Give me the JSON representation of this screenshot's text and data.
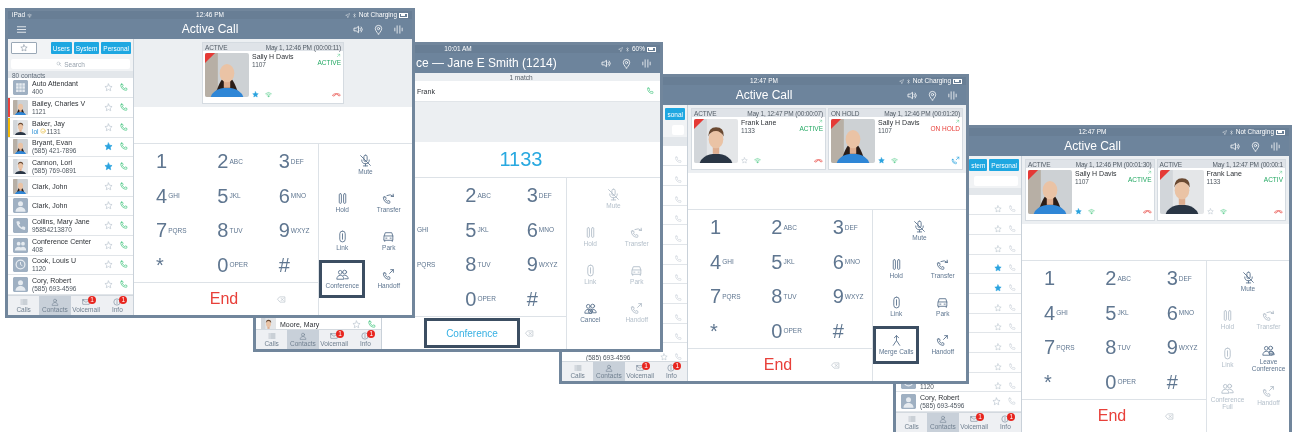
{
  "screens": [
    {
      "kind": "call",
      "status_bar": {
        "carrier": "iPad",
        "time": "12:46 PM",
        "battery": "Not Charging"
      },
      "title_bar": {
        "title": "Active Call",
        "menu": true
      },
      "sidebar": {
        "filters": [
          {
            "kind": "favorites"
          },
          {
            "kind": "text",
            "label": "Users"
          },
          {
            "kind": "text",
            "label": "System"
          },
          {
            "kind": "text",
            "label": "Personal"
          }
        ],
        "search_field": true,
        "search_placeholder": "Search",
        "count": "80 contacts",
        "contacts": [
          {
            "name": "Auto Attendant",
            "number": "400",
            "avatar": {
              "kind": "grid"
            },
            "favorite": false,
            "call_enabled": true
          },
          {
            "name": "Bailey, Charles V",
            "number": "1121",
            "color": "#e8403a",
            "favorite": false,
            "call_enabled": true
          },
          {
            "name": "Baker, Jay",
            "note": "lol",
            "number": "1131",
            "color": "#f2b705",
            "favorite": false,
            "call_enabled": true
          },
          {
            "name": "Bryant, Evan",
            "number": "(585) 421-7896",
            "favorite": true,
            "call_enabled": true
          },
          {
            "name": "Cannon, Lori",
            "number": "(585) 769-0891",
            "favorite": true,
            "call_enabled": true
          },
          {
            "name": "Clark, John",
            "favorite": false,
            "call_enabled": true
          },
          {
            "name": "Clark, John",
            "avatar": {
              "kind": "person"
            },
            "favorite": false,
            "call_enabled": true
          },
          {
            "name": "Collins, Mary Jane",
            "number": "95854213870",
            "avatar": {
              "kind": "phone"
            },
            "favorite": false,
            "call_enabled": true
          },
          {
            "name": "Conference Center",
            "number": "408",
            "avatar": {
              "kind": "group"
            },
            "favorite": false,
            "call_enabled": true
          },
          {
            "name": "Cook, Louis U",
            "number": "1120",
            "avatar": {
              "kind": "clock"
            },
            "favorite": false,
            "call_enabled": true
          },
          {
            "name": "Cory, Robert",
            "number": "(585) 693-4596",
            "avatar": {
              "kind": "person"
            },
            "favorite": false,
            "call_enabled": true
          }
        ],
        "tabs": [
          {
            "label": "Calls",
            "selected": false
          },
          {
            "label": "Contacts",
            "selected": true
          },
          {
            "label": "Voicemail",
            "selected": false,
            "badge": "1"
          },
          {
            "label": "Info",
            "selected": false,
            "badge": "1"
          }
        ]
      },
      "calls": [
        {
          "header": "ACTIVE",
          "date": "May 1, 12:46 PM",
          "duration": "(00:00:11)",
          "name": "Sally H Davis",
          "number": "1107",
          "status": "ACTIVE",
          "on_hold": false,
          "favorite": true
        }
      ],
      "keypad": [
        [
          {
            "digit": "1"
          },
          {
            "digit": "2",
            "letters": "ABC"
          },
          {
            "digit": "3",
            "letters": "DEF"
          }
        ],
        [
          {
            "digit": "4",
            "letters": "GHI"
          },
          {
            "digit": "5",
            "letters": "JKL"
          },
          {
            "digit": "6",
            "letters": "MNO"
          }
        ],
        [
          {
            "digit": "7",
            "letters": "PQRS"
          },
          {
            "digit": "8",
            "letters": "TUV"
          },
          {
            "digit": "9",
            "letters": "WXYZ"
          }
        ],
        [
          {
            "digit": "*"
          },
          {
            "digit": "0",
            "letters": "OPER"
          },
          {
            "digit": "#"
          }
        ]
      ],
      "actions": [
        {
          "kind": "mute",
          "label": "Mute",
          "disabled": false,
          "highlighted": false
        },
        {
          "kind": "hold",
          "label": "Hold",
          "disabled": false,
          "highlighted": false
        },
        {
          "kind": "transfer",
          "label": "Transfer",
          "disabled": false,
          "highlighted": false
        },
        {
          "kind": "link",
          "label": "Link",
          "disabled": false,
          "highlighted": false
        },
        {
          "kind": "park",
          "label": "Park",
          "disabled": false,
          "highlighted": false
        },
        {
          "kind": "conference",
          "label": "Conference",
          "disabled": false,
          "highlighted": true
        },
        {
          "kind": "handoff",
          "label": "Handoff",
          "disabled": false,
          "highlighted": false
        }
      ],
      "bottom": {
        "kind": "end",
        "label": "End",
        "highlighted": false
      }
    },
    {
      "kind": "dial",
      "status_bar": {
        "time": "10:01 AM",
        "battery": "60%"
      },
      "title_bar": {
        "title": "ce — Jane E Smith (1214)"
      },
      "sidebar": {
        "contacts": [
          {
            "name": "Moore, Mary",
            "favorite": false,
            "call_enabled": true
          }
        ],
        "tabs": [
          {
            "label": "Calls",
            "selected": false
          },
          {
            "label": "Contacts",
            "selected": true
          },
          {
            "label": "Voicemail",
            "selected": false,
            "badge": "1"
          },
          {
            "label": "Info",
            "selected": false,
            "badge": "1"
          }
        ]
      },
      "search_results": {
        "summary": "1 match",
        "items": [
          {
            "name": "Frank"
          }
        ]
      },
      "dial_display": "1133",
      "keypad": [
        [
          {
            "digit": "2",
            "letters": "ABC"
          },
          {
            "digit": "3",
            "letters": "DEF"
          }
        ],
        [
          {
            "letters": "GHI"
          },
          {
            "digit": "5",
            "letters": "JKL"
          },
          {
            "digit": "6",
            "letters": "MNO"
          }
        ],
        [
          {
            "letters": "PQRS"
          },
          {
            "digit": "8",
            "letters": "TUV"
          },
          {
            "digit": "9",
            "letters": "WXYZ"
          }
        ],
        [
          {
            "digit": "0",
            "letters": "OPER"
          },
          {
            "digit": "#"
          }
        ]
      ],
      "actions": [
        {
          "kind": "mute",
          "label": "Mute",
          "disabled": true,
          "highlighted": false
        },
        {
          "kind": "hold",
          "label": "Hold",
          "disabled": true,
          "highlighted": false
        },
        {
          "kind": "transfer",
          "label": "Transfer",
          "disabled": true,
          "highlighted": false
        },
        {
          "kind": "link",
          "label": "Link",
          "disabled": true,
          "highlighted": false
        },
        {
          "kind": "park",
          "label": "Park",
          "disabled": true,
          "highlighted": false
        },
        {
          "kind": "cancel",
          "label": "Cancel",
          "disabled": false,
          "highlighted": false
        },
        {
          "kind": "handoff",
          "label": "Handoff",
          "disabled": true,
          "highlighted": false
        }
      ],
      "bottom": {
        "kind": "conference",
        "label": "Conference",
        "highlighted": true
      }
    },
    {
      "kind": "call",
      "status_bar": {
        "time": "12:47 PM",
        "battery": "Not Charging"
      },
      "title_bar": {
        "title": "Active Call"
      },
      "sidebar": {
        "filters": [
          {
            "kind": "text",
            "label": "sonal"
          }
        ],
        "search_field": true,
        "contacts": [
          {
            "call_enabled": false
          },
          {
            "call_enabled": false
          },
          {
            "call_enabled": false
          },
          {
            "call_enabled": false
          },
          {
            "call_enabled": false
          },
          {
            "call_enabled": false
          },
          {
            "call_enabled": false
          },
          {
            "call_enabled": false
          },
          {
            "call_enabled": false
          },
          {
            "call_enabled": false
          },
          {
            "number": "(585) 693-4596",
            "favorite": false,
            "call_enabled": false
          }
        ],
        "tabs": [
          {
            "label": "Calls",
            "selected": false
          },
          {
            "label": "Contacts",
            "selected": true
          },
          {
            "label": "Voicemail",
            "selected": false,
            "badge": "1"
          },
          {
            "label": "Info",
            "selected": false,
            "badge": "1"
          }
        ]
      },
      "calls": [
        {
          "header": "ACTIVE",
          "date": "May 1, 12:47 PM",
          "duration": "(00:00:07)",
          "name": "Frank Lane",
          "number": "1133",
          "status": "ACTIVE",
          "on_hold": false,
          "favorite": false
        },
        {
          "header": "ON HOLD",
          "date": "May 1, 12:46 PM",
          "duration": "(00:01:20)",
          "name": "Sally H Davis",
          "number": "1107",
          "status": "ON HOLD",
          "on_hold": true,
          "favorite": true
        }
      ],
      "keypad": [
        [
          {
            "digit": "1"
          },
          {
            "digit": "2",
            "letters": "ABC"
          },
          {
            "digit": "3",
            "letters": "DEF"
          }
        ],
        [
          {
            "digit": "4",
            "letters": "GHI"
          },
          {
            "digit": "5",
            "letters": "JKL"
          },
          {
            "digit": "6",
            "letters": "MNO"
          }
        ],
        [
          {
            "digit": "7",
            "letters": "PQRS"
          },
          {
            "digit": "8",
            "letters": "TUV"
          },
          {
            "digit": "9",
            "letters": "WXYZ"
          }
        ],
        [
          {
            "digit": "*"
          },
          {
            "digit": "0",
            "letters": "OPER"
          },
          {
            "digit": "#"
          }
        ]
      ],
      "actions": [
        {
          "kind": "mute",
          "label": "Mute",
          "disabled": false,
          "highlighted": false
        },
        {
          "kind": "hold",
          "label": "Hold",
          "disabled": false,
          "highlighted": false
        },
        {
          "kind": "transfer",
          "label": "Transfer",
          "disabled": false,
          "highlighted": false
        },
        {
          "kind": "link",
          "label": "Link",
          "disabled": false,
          "highlighted": false
        },
        {
          "kind": "park",
          "label": "Park",
          "disabled": false,
          "highlighted": false
        },
        {
          "kind": "merge",
          "label": "Merge Calls",
          "disabled": false,
          "highlighted": true
        },
        {
          "kind": "handoff",
          "label": "Handoff",
          "disabled": false,
          "highlighted": false
        }
      ],
      "bottom": {
        "kind": "end",
        "label": "End",
        "highlighted": false
      }
    },
    {
      "kind": "call",
      "status_bar": {
        "time": "12:47 PM",
        "battery": "Not Charging"
      },
      "title_bar": {
        "title": "Active Call"
      },
      "sidebar": {
        "filters": [
          {
            "kind": "text",
            "label": "stem"
          },
          {
            "kind": "text",
            "label": "Personal"
          }
        ],
        "search_field": true,
        "contacts": [
          {
            "favorite": false,
            "call_enabled": false
          },
          {
            "favorite": false,
            "call_enabled": false
          },
          {
            "favorite": false,
            "call_enabled": false
          },
          {
            "favorite": true,
            "call_enabled": false
          },
          {
            "favorite": true,
            "call_enabled": false
          },
          {
            "favorite": false,
            "call_enabled": false
          },
          {
            "favorite": false,
            "call_enabled": false
          },
          {
            "favorite": false,
            "call_enabled": false
          },
          {
            "favorite": false,
            "call_enabled": false
          },
          {
            "number": "1120",
            "avatar": {
              "kind": "clock"
            },
            "favorite": false,
            "call_enabled": false
          },
          {
            "name": "Cory, Robert",
            "number": "(585) 693-4596",
            "avatar": {
              "kind": "person"
            },
            "favorite": false,
            "call_enabled": false
          }
        ],
        "tabs": [
          {
            "label": "Calls",
            "selected": false
          },
          {
            "label": "Contacts",
            "selected": true
          },
          {
            "label": "Voicemail",
            "selected": false,
            "badge": "1"
          },
          {
            "label": "Info",
            "selected": false,
            "badge": "1"
          }
        ]
      },
      "calls": [
        {
          "header": "ACTIVE",
          "date": "May 1, 12:46 PM",
          "duration": "(00:01:30)",
          "name": "Sally H Davis",
          "number": "1107",
          "status": "ACTIVE",
          "on_hold": false,
          "favorite": true
        },
        {
          "header": "ACTIVE",
          "date": "May 1, 12:47 PM",
          "duration": "(00:00:1",
          "name": "Frank Lane",
          "number": "1133",
          "status": "ACTIV",
          "on_hold": false,
          "favorite": false
        }
      ],
      "keypad": [
        [
          {
            "digit": "1"
          },
          {
            "digit": "2",
            "letters": "ABC"
          },
          {
            "digit": "3",
            "letters": "DEF"
          }
        ],
        [
          {
            "digit": "4",
            "letters": "GHI"
          },
          {
            "digit": "5",
            "letters": "JKL"
          },
          {
            "digit": "6",
            "letters": "MNO"
          }
        ],
        [
          {
            "digit": "7",
            "letters": "PQRS"
          },
          {
            "digit": "8",
            "letters": "TUV"
          },
          {
            "digit": "9",
            "letters": "WXYZ"
          }
        ],
        [
          {
            "digit": "*"
          },
          {
            "digit": "0",
            "letters": "OPER"
          },
          {
            "digit": "#"
          }
        ]
      ],
      "actions": [
        {
          "kind": "mute",
          "label": "Mute",
          "disabled": false,
          "highlighted": false
        },
        {
          "kind": "hold",
          "label": "Hold",
          "disabled": true,
          "highlighted": false
        },
        {
          "kind": "transfer",
          "label": "Transfer",
          "disabled": true,
          "highlighted": false
        },
        {
          "kind": "link",
          "label": "Link",
          "disabled": true,
          "highlighted": false
        },
        {
          "kind": "leave",
          "label": "Leave Conference",
          "disabled": false,
          "highlighted": false
        },
        {
          "kind": "conference_full",
          "label": "Conference Full",
          "disabled": true,
          "highlighted": false
        },
        {
          "kind": "handoff",
          "label": "Handoff",
          "disabled": true,
          "highlighted": false
        }
      ],
      "bottom": {
        "kind": "end",
        "label": "End",
        "highlighted": false
      }
    }
  ]
}
